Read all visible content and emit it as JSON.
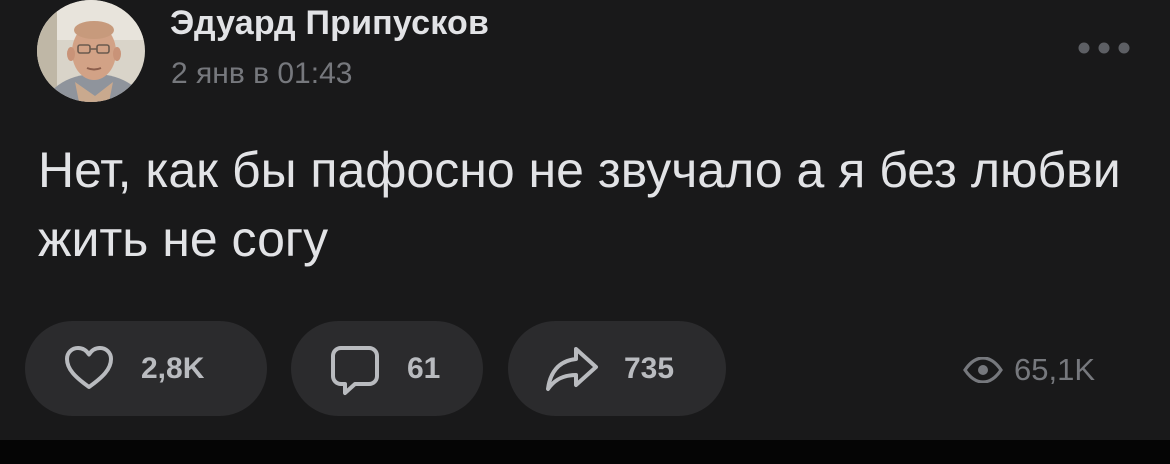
{
  "author": {
    "name": "Эдуард Припусков",
    "time": "2 янв в 01:43"
  },
  "post": {
    "text": "Нет, как бы пафосно не звучало а я без любви жить не согу"
  },
  "actions": {
    "likes": "2,8K",
    "comments": "61",
    "shares": "735",
    "views": "65,1K"
  },
  "icons": {
    "like": "heart-icon",
    "comment": "comment-icon",
    "share": "share-icon",
    "views": "eye-icon",
    "more": "more-dots-icon"
  },
  "colors": {
    "background": "#19191a",
    "pill": "#2b2b2d",
    "primary_text": "#e2e3e6",
    "secondary_text": "#76787d",
    "action_text": "#b9bbbf"
  }
}
